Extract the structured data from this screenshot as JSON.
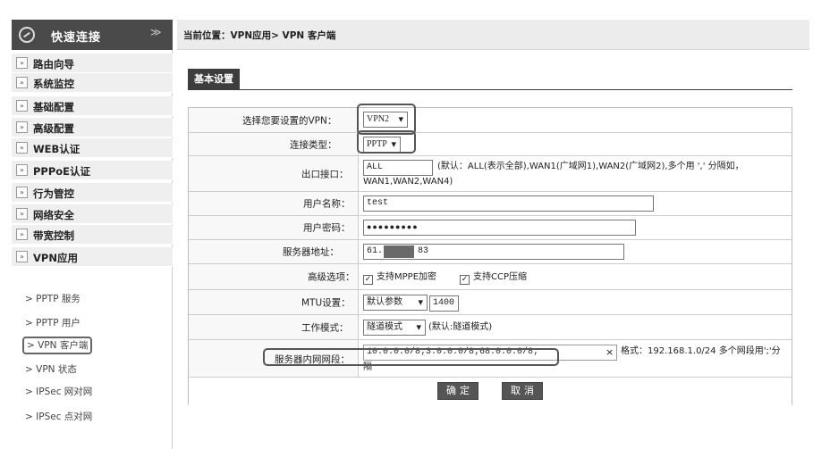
{
  "sidebar": {
    "title": "快速连接",
    "arrow_glyph": "»",
    "items": [
      {
        "label": "路由向导"
      },
      {
        "label": "系统监控"
      },
      {
        "label": "基础配置"
      },
      {
        "label": "高级配置"
      },
      {
        "label": "WEB认证"
      },
      {
        "label": "PPPoE认证"
      },
      {
        "label": "行为管控"
      },
      {
        "label": "网络安全"
      },
      {
        "label": "带宽控制"
      },
      {
        "label": "VPN应用"
      }
    ],
    "subitems": [
      {
        "label": "> PPTP 服务"
      },
      {
        "label": "> PPTP 用户"
      },
      {
        "label": "> VPN 客户端"
      },
      {
        "label": "> VPN 状态"
      },
      {
        "label": "> IPSec 网对网"
      },
      {
        "label": "> IPSec 点对网"
      }
    ]
  },
  "breadcrumb": "当前位置：VPN应用> VPN 客户端",
  "section_title": "基本设置",
  "form": {
    "vpn_select": {
      "label": "选择您要设置的VPN：",
      "value": "VPN2"
    },
    "conn_type": {
      "label": "连接类型：",
      "value": "PPTP"
    },
    "outlet": {
      "label": "出口接口：",
      "value": "ALL",
      "hint": "(默认：ALL(表示全部),WAN1(广域网1),WAN2(广域网2),多个用 ',' 分隔如，",
      "hint2": "WAN1,WAN2,WAN4)"
    },
    "username": {
      "label": "用户名称：",
      "value": "test"
    },
    "password": {
      "label": "用户密码：",
      "value": "●●●●●●●●●"
    },
    "server": {
      "label": "服务器地址：",
      "value_prefix": "61.",
      "value_suffix": "83"
    },
    "advanced": {
      "label": "高级选项：",
      "opt1": "支持MPPE加密",
      "opt2": "支持CCP压缩",
      "check": "✓"
    },
    "mtu": {
      "label": "MTU设置：",
      "select": "默认参数",
      "value": "1400"
    },
    "mode": {
      "label": "工作模式：",
      "value": "隧道模式",
      "hint": "(默认:隧道模式)"
    },
    "subnet": {
      "label": "服务器内网网段：",
      "value": "10.0.0.0/8;3.0.0.0/8;68.0.0.0/8;",
      "clear": "×",
      "hint": "格式：192.168.1.0/24 多个网段用';'分",
      "hint2": "隔"
    }
  },
  "buttons": {
    "ok": "确定",
    "cancel": "取消"
  },
  "icons": {
    "chevron": "▾",
    "sidebar_collapse": "≫"
  }
}
